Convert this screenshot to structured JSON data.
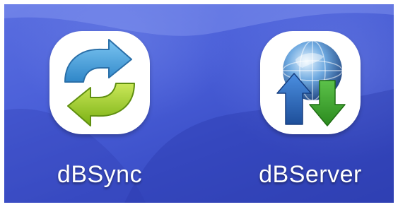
{
  "home_screen": {
    "apps": [
      {
        "label": "dBSync",
        "icon": "sync-arrows-icon"
      },
      {
        "label": "dBServer",
        "icon": "globe-up-down-arrows-icon"
      }
    ]
  },
  "colors": {
    "wallpaper": "#4a5fd8",
    "icon_background": "#ffffff",
    "sync_blue": "#3a9ad6",
    "sync_green": "#8fc21c",
    "server_blue_arrow": "#2f6fc0",
    "server_green_arrow": "#3a9a2a",
    "label_text": "#ffffff"
  }
}
